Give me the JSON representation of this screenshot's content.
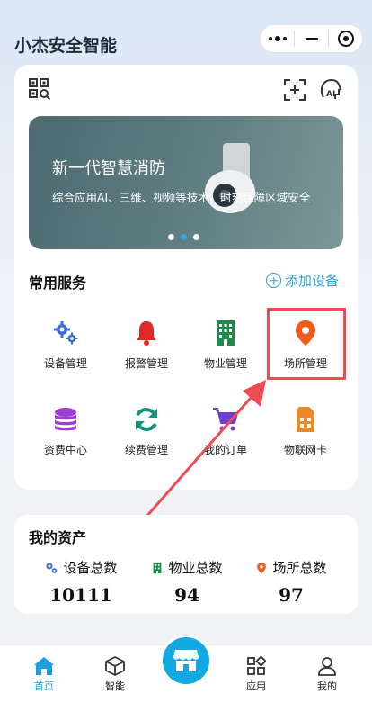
{
  "app": {
    "title": "小杰安全智能"
  },
  "capsule": {
    "more_icon": "more-dots-icon",
    "minimize_icon": "minimize-icon",
    "close_icon": "target-icon"
  },
  "toolbar": {
    "icons": [
      "qr-scan-icon",
      "scan-frame-icon",
      "ai-assistant-icon"
    ]
  },
  "banner": {
    "title": "新一代智慧消防",
    "subtitle": "综合应用AI、三维、视频等技术，时刻保障区域安全",
    "slide_count": 3,
    "active_slide": 2
  },
  "services": {
    "heading": "常用服务",
    "add_label": "添加设备",
    "items": [
      {
        "label": "设备管理",
        "icon": "gears-icon",
        "color": "#3a6fd8"
      },
      {
        "label": "报警管理",
        "icon": "bell-icon",
        "color": "#e02828"
      },
      {
        "label": "物业管理",
        "icon": "building-icon",
        "color": "#1f8a4c"
      },
      {
        "label": "场所管理",
        "icon": "location-pin-icon",
        "color": "#f05a1a"
      },
      {
        "label": "资费中心",
        "icon": "coins-icon",
        "color": "#9b3fd0"
      },
      {
        "label": "续费管理",
        "icon": "refresh-icon",
        "color": "#14937a"
      },
      {
        "label": "我的订单",
        "icon": "cart-icon",
        "color": "#6a3fd0"
      },
      {
        "label": "物联网卡",
        "icon": "sim-card-icon",
        "color": "#e8892a"
      }
    ]
  },
  "assets": {
    "heading": "我的资产",
    "stats": [
      {
        "label": "设备总数",
        "value": "10111",
        "icon": "gears-icon",
        "color": "#3a6fd8"
      },
      {
        "label": "物业总数",
        "value": "94",
        "icon": "building-icon",
        "color": "#1f8a4c"
      },
      {
        "label": "场所总数",
        "value": "97",
        "icon": "location-pin-icon",
        "color": "#f05a1a"
      }
    ]
  },
  "tabs": [
    {
      "label": "首页",
      "icon": "home-icon",
      "active": true
    },
    {
      "label": "智能",
      "icon": "cube-icon",
      "active": false
    },
    {
      "label": "应用",
      "icon": "apps-grid-icon",
      "active": false
    },
    {
      "label": "我的",
      "icon": "user-icon",
      "active": false
    }
  ],
  "center_button": {
    "icon": "store-icon"
  },
  "colors": {
    "accent": "#2a9fd6",
    "highlight": "#ee4b52"
  }
}
